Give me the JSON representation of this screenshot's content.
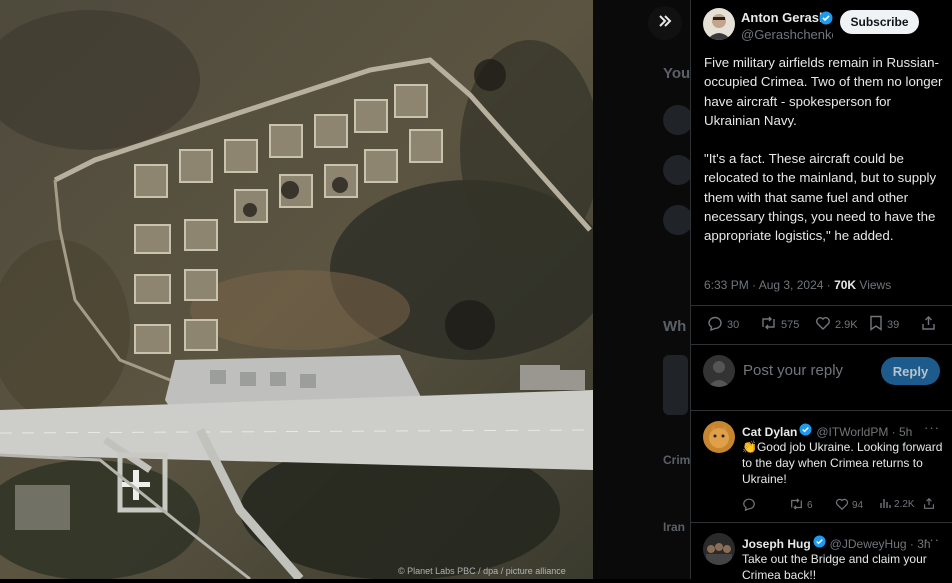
{
  "viewer": {
    "image_credit": "© Planet Labs PBC / dpa / picture alliance",
    "collapse_icon": "double-chevron-right"
  },
  "backdrop": {
    "heading_1": "You",
    "heading_2": "Wh",
    "item_1": "Crim",
    "item_2": "Iran"
  },
  "tweet": {
    "author_name": "Anton Gerash",
    "author_handle": "@Gerashchenko_",
    "subscribe_label": "Subscribe",
    "paragraph_1": "Five military airfields remain in Russian-occupied Crimea. Two of them no longer have aircraft - spokesperson for Ukrainian Navy.",
    "paragraph_2": "\"It's a fact. These aircraft could be relocated to the mainland, but to supply them with that same fuel and other necessary things, you need to have the appropriate logistics,\" he added.",
    "timestamp": "6:33 PM · Aug 3, 2024 · ",
    "views_count": "70K",
    "views_label": " Views",
    "replies": "30",
    "reposts": "575",
    "likes": "2.9K",
    "bookmarks": "39"
  },
  "compose": {
    "placeholder": "Post your reply",
    "reply_label": "Reply"
  },
  "replies": [
    {
      "name": "Cat Dylan",
      "handle": "@ITWorldPM · 5h",
      "text": "👏Good job Ukraine.  Looking forward to the day when Crimea returns to Ukraine!",
      "reposts": "6",
      "likes": "94",
      "views": "2.2K"
    },
    {
      "name": "Joseph Hug",
      "handle": "@JDeweyHug · 3h",
      "text": "Take out the Bridge and claim your Crimea back!!"
    }
  ],
  "colors": {
    "accent": "#1d9bf0",
    "background": "#000000",
    "muted": "#71767b"
  }
}
